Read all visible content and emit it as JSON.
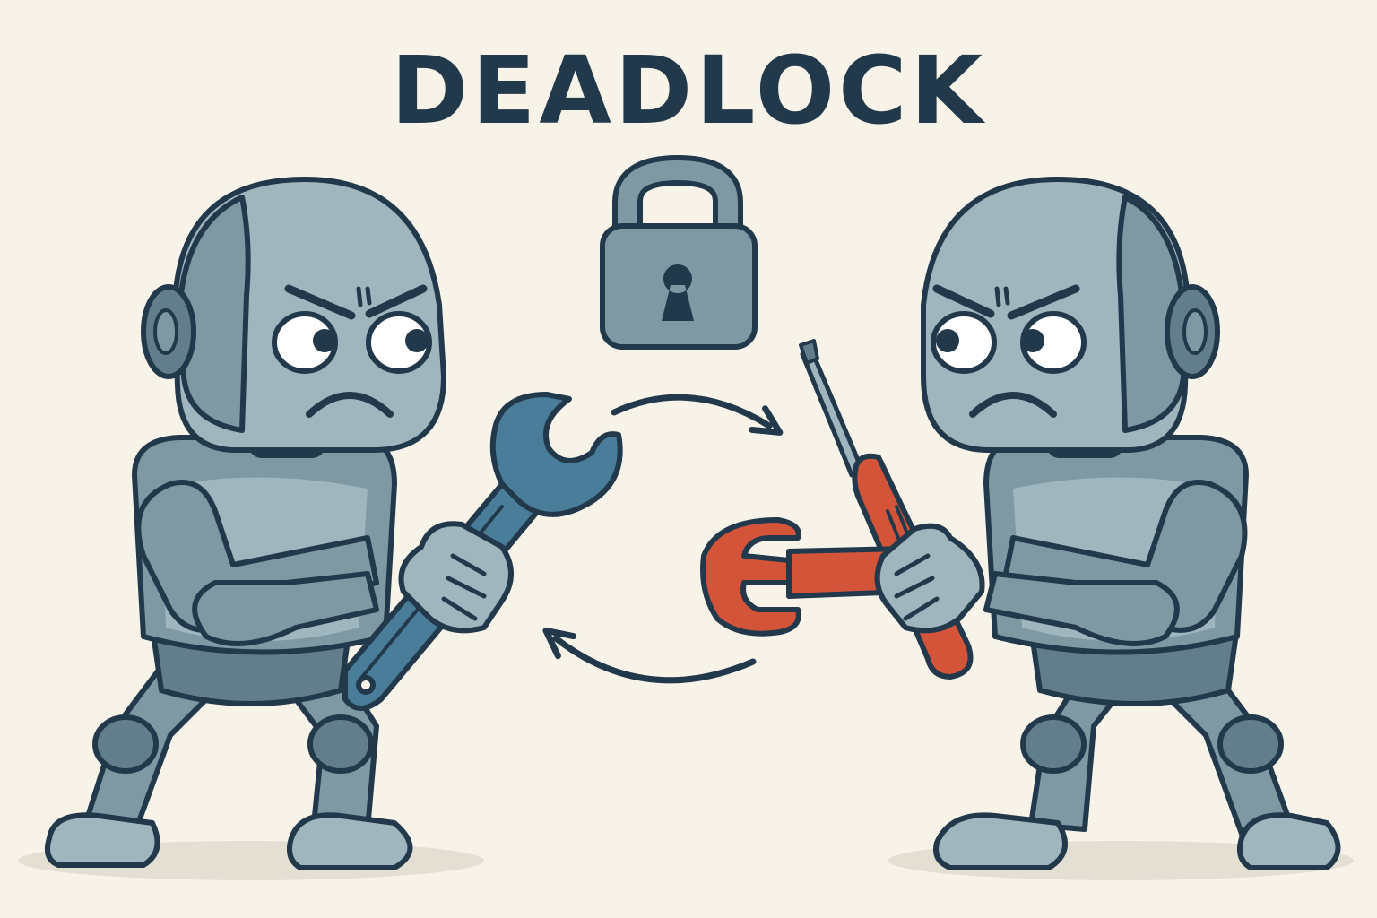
{
  "title": "DEADLOCK",
  "colors": {
    "background": "#f8f3e9",
    "ink": "#22394b",
    "robot_light": "#9fb6bf",
    "robot_mid": "#7f99a4",
    "robot_dark": "#627e8b",
    "wrench_blue": "#4a7d99",
    "tool_red": "#d4543a",
    "lock_body": "#7f99a4"
  },
  "elements": {
    "left_robot": {
      "expression": "angry",
      "holding": "wrench"
    },
    "right_robot": {
      "expression": "angry",
      "holding": "screwdriver",
      "reaching_for": "wrench"
    },
    "lock": {
      "icon": "padlock-icon"
    },
    "cycle": {
      "arrows": 2,
      "direction": "circular"
    }
  }
}
